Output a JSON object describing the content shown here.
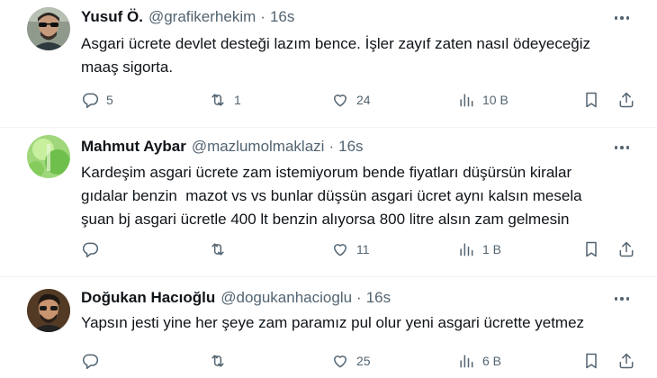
{
  "tweets": [
    {
      "name": "Yusuf Ö.",
      "handle": "@grafikerhekim",
      "separator": "·",
      "time": "16s",
      "text_lines": [
        "Asgari ücrete devlet desteği lazım bence. İşler zayıf zaten nasıl ödeyeceğiz",
        "maaş sigorta."
      ],
      "replies": "5",
      "retweets": "1",
      "likes": "24",
      "views": "10 B"
    },
    {
      "name": "Mahmut Aybar",
      "handle": "@mazlumolmaklazi",
      "separator": "·",
      "time": "16s",
      "text_lines": [
        "Kardeşim asgari ücrete zam istemiyorum bende fiyatları düşürsün kiralar",
        "gıdalar benzin  mazot vs vs bunlar düşsün asgari ücret aynı kalsın mesela",
        "şuan bj asgari ücretle 400 lt benzin alıyorsa 800 litre alsın zam gelmesin"
      ],
      "replies": "",
      "retweets": "",
      "likes": "11",
      "views": "1 B"
    },
    {
      "name": "Doğukan Hacıoğlu",
      "handle": "@dogukanhacioglu",
      "separator": "·",
      "time": "16s",
      "text_lines": [
        "Yapsın jesti yine her şeye zam paramız pul olur yeni asgari ücrette yetmez"
      ],
      "replies": "",
      "retweets": "",
      "likes": "25",
      "views": "6 B"
    }
  ],
  "icons": {
    "reply": "reply-icon",
    "retweet": "retweet-icon",
    "like": "heart-icon",
    "views": "views-chart-icon",
    "bookmark": "bookmark-icon",
    "share": "share-icon",
    "more": "more-dots-icon"
  },
  "colors": {
    "text_primary": "#0f1419",
    "text_secondary": "#536471",
    "divider": "#eff3f4"
  }
}
